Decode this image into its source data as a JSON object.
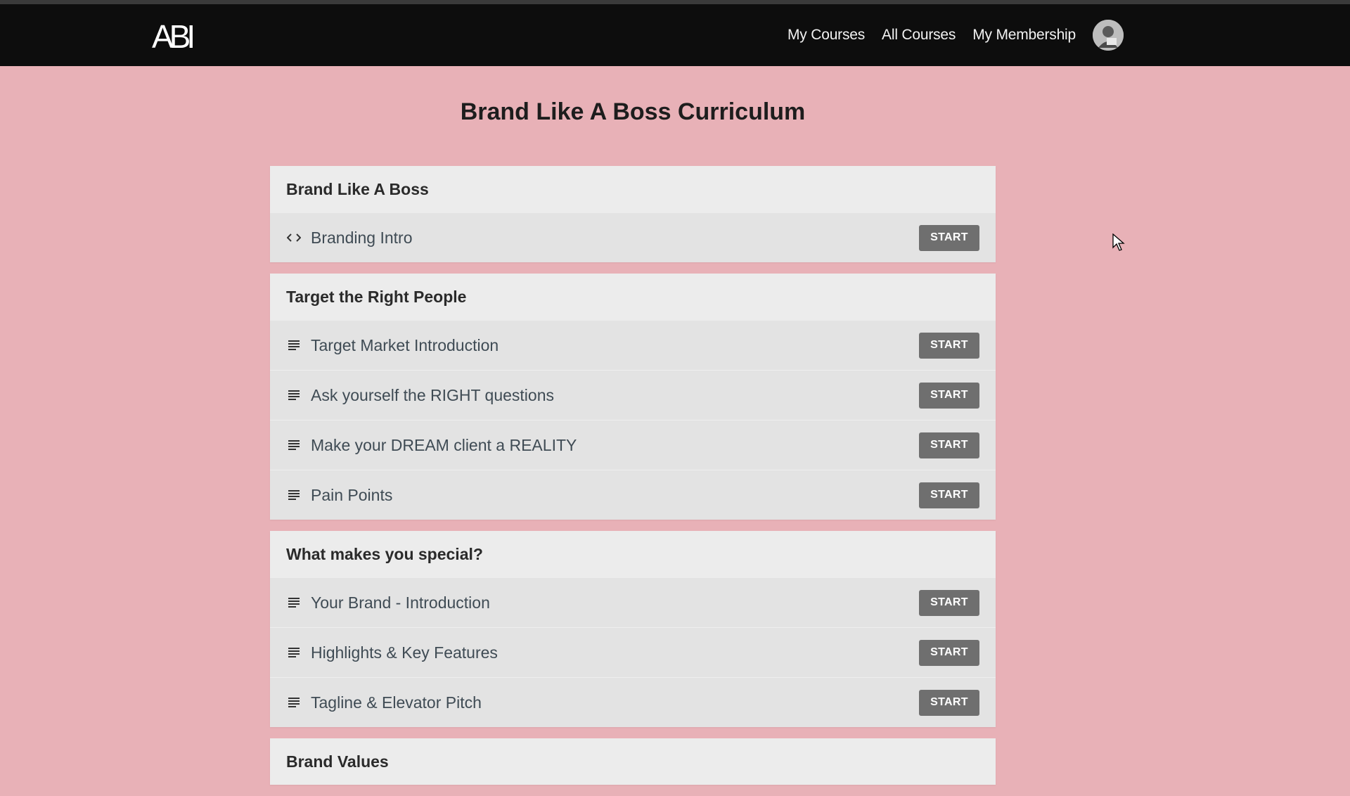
{
  "header": {
    "logo_text": "ABI",
    "nav": [
      {
        "label": "My Courses"
      },
      {
        "label": "All Courses"
      },
      {
        "label": "My Membership"
      }
    ]
  },
  "page": {
    "title": "Brand Like A Boss Curriculum"
  },
  "sections": [
    {
      "title": "Brand Like A Boss",
      "lectures": [
        {
          "title": "Branding Intro",
          "icon": "code-icon",
          "action": "START"
        }
      ]
    },
    {
      "title": "Target the Right People",
      "lectures": [
        {
          "title": "Target Market Introduction",
          "icon": "text-lines-icon",
          "action": "START"
        },
        {
          "title": "Ask yourself the RIGHT questions",
          "icon": "text-lines-icon",
          "action": "START"
        },
        {
          "title": "Make your DREAM client a REALITY",
          "icon": "text-lines-icon",
          "action": "START"
        },
        {
          "title": "Pain Points",
          "icon": "text-lines-icon",
          "action": "START"
        }
      ]
    },
    {
      "title": "What makes you special?",
      "lectures": [
        {
          "title": "Your Brand - Introduction",
          "icon": "text-lines-icon",
          "action": "START"
        },
        {
          "title": "Highlights & Key Features",
          "icon": "text-lines-icon",
          "action": "START"
        },
        {
          "title": "Tagline & Elevator Pitch",
          "icon": "text-lines-icon",
          "action": "START"
        }
      ]
    },
    {
      "title": "Brand Values",
      "lectures": []
    }
  ],
  "colors": {
    "background": "#e8b1b7",
    "navbar": "#0d0d0d",
    "button": "#6f6f6f"
  }
}
